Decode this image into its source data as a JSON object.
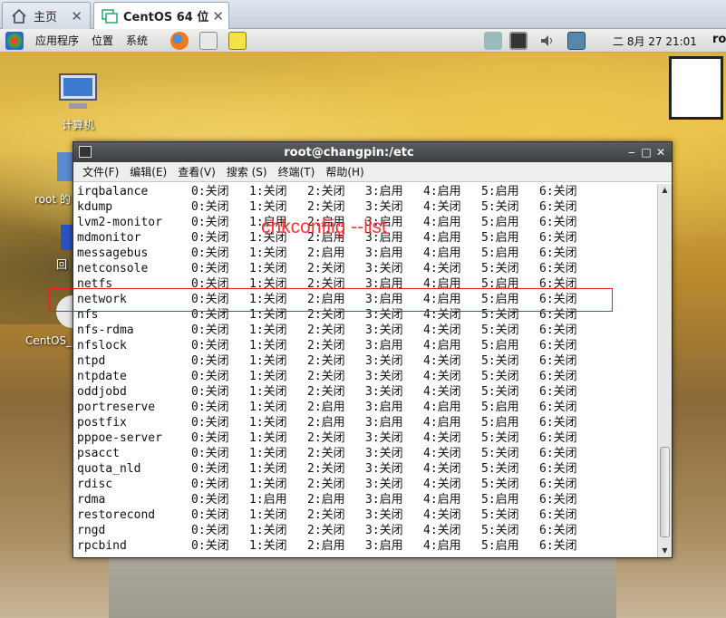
{
  "host_tabs": [
    {
      "label": "主页",
      "icon": "home-icon"
    },
    {
      "label": "CentOS 64 位",
      "icon": "vm-icon",
      "close": "✕"
    }
  ],
  "home_close": "✕",
  "panel": {
    "menus": [
      "应用程序",
      "位置",
      "系统"
    ],
    "clock": "二 8月 27 21:01",
    "user": "ro"
  },
  "desktop": {
    "icons": [
      {
        "label": "计算机",
        "icon": "computer-icon"
      },
      {
        "label": "root 的",
        "icon": "home-folder-icon"
      },
      {
        "label": "回",
        "icon": "trash-icon"
      },
      {
        "label": "CentOS_",
        "icon": "disc-icon"
      }
    ]
  },
  "terminal": {
    "title": "root@changpin:/etc",
    "window_buttons": [
      "‒",
      "□",
      "✕"
    ],
    "menu": [
      "文件(F)",
      "编辑(E)",
      "查看(V)",
      "搜索 (S)",
      "终端(T)",
      "帮助(H)"
    ],
    "rows": [
      {
        "name": "irqbalance",
        "levels": [
          "0:关闭",
          "1:关闭",
          "2:关闭",
          "3:启用",
          "4:启用",
          "5:启用",
          "6:关闭"
        ]
      },
      {
        "name": "kdump",
        "levels": [
          "0:关闭",
          "1:关闭",
          "2:关闭",
          "3:关闭",
          "4:关闭",
          "5:关闭",
          "6:关闭"
        ]
      },
      {
        "name": "lvm2-monitor",
        "levels": [
          "0:关闭",
          "1:启用",
          "2:启用",
          "3:启用",
          "4:启用",
          "5:启用",
          "6:关闭"
        ]
      },
      {
        "name": "mdmonitor",
        "levels": [
          "0:关闭",
          "1:关闭",
          "2:启用",
          "3:启用",
          "4:启用",
          "5:启用",
          "6:关闭"
        ]
      },
      {
        "name": "messagebus",
        "levels": [
          "0:关闭",
          "1:关闭",
          "2:启用",
          "3:启用",
          "4:启用",
          "5:启用",
          "6:关闭"
        ]
      },
      {
        "name": "netconsole",
        "levels": [
          "0:关闭",
          "1:关闭",
          "2:关闭",
          "3:关闭",
          "4:关闭",
          "5:关闭",
          "6:关闭"
        ]
      },
      {
        "name": "netfs",
        "levels": [
          "0:关闭",
          "1:关闭",
          "2:关闭",
          "3:启用",
          "4:启用",
          "5:启用",
          "6:关闭"
        ]
      },
      {
        "name": "network",
        "levels": [
          "0:关闭",
          "1:关闭",
          "2:启用",
          "3:启用",
          "4:启用",
          "5:启用",
          "6:关闭"
        ]
      },
      {
        "name": "nfs",
        "levels": [
          "0:关闭",
          "1:关闭",
          "2:关闭",
          "3:关闭",
          "4:关闭",
          "5:关闭",
          "6:关闭"
        ]
      },
      {
        "name": "nfs-rdma",
        "levels": [
          "0:关闭",
          "1:关闭",
          "2:关闭",
          "3:关闭",
          "4:关闭",
          "5:关闭",
          "6:关闭"
        ]
      },
      {
        "name": "nfslock",
        "levels": [
          "0:关闭",
          "1:关闭",
          "2:关闭",
          "3:启用",
          "4:启用",
          "5:启用",
          "6:关闭"
        ]
      },
      {
        "name": "ntpd",
        "levels": [
          "0:关闭",
          "1:关闭",
          "2:关闭",
          "3:关闭",
          "4:关闭",
          "5:关闭",
          "6:关闭"
        ]
      },
      {
        "name": "ntpdate",
        "levels": [
          "0:关闭",
          "1:关闭",
          "2:关闭",
          "3:关闭",
          "4:关闭",
          "5:关闭",
          "6:关闭"
        ]
      },
      {
        "name": "oddjobd",
        "levels": [
          "0:关闭",
          "1:关闭",
          "2:关闭",
          "3:关闭",
          "4:关闭",
          "5:关闭",
          "6:关闭"
        ]
      },
      {
        "name": "portreserve",
        "levels": [
          "0:关闭",
          "1:关闭",
          "2:启用",
          "3:启用",
          "4:启用",
          "5:启用",
          "6:关闭"
        ]
      },
      {
        "name": "postfix",
        "levels": [
          "0:关闭",
          "1:关闭",
          "2:启用",
          "3:启用",
          "4:启用",
          "5:启用",
          "6:关闭"
        ]
      },
      {
        "name": "pppoe-server",
        "levels": [
          "0:关闭",
          "1:关闭",
          "2:关闭",
          "3:关闭",
          "4:关闭",
          "5:关闭",
          "6:关闭"
        ]
      },
      {
        "name": "psacct",
        "levels": [
          "0:关闭",
          "1:关闭",
          "2:关闭",
          "3:关闭",
          "4:关闭",
          "5:关闭",
          "6:关闭"
        ]
      },
      {
        "name": "quota_nld",
        "levels": [
          "0:关闭",
          "1:关闭",
          "2:关闭",
          "3:关闭",
          "4:关闭",
          "5:关闭",
          "6:关闭"
        ]
      },
      {
        "name": "rdisc",
        "levels": [
          "0:关闭",
          "1:关闭",
          "2:关闭",
          "3:关闭",
          "4:关闭",
          "5:关闭",
          "6:关闭"
        ]
      },
      {
        "name": "rdma",
        "levels": [
          "0:关闭",
          "1:启用",
          "2:启用",
          "3:启用",
          "4:启用",
          "5:启用",
          "6:关闭"
        ]
      },
      {
        "name": "restorecond",
        "levels": [
          "0:关闭",
          "1:关闭",
          "2:关闭",
          "3:关闭",
          "4:关闭",
          "5:关闭",
          "6:关闭"
        ]
      },
      {
        "name": "rngd",
        "levels": [
          "0:关闭",
          "1:关闭",
          "2:关闭",
          "3:关闭",
          "4:关闭",
          "5:关闭",
          "6:关闭"
        ]
      },
      {
        "name": "rpcbind",
        "levels": [
          "0:关闭",
          "1:关闭",
          "2:启用",
          "3:启用",
          "4:启用",
          "5:启用",
          "6:关闭"
        ]
      }
    ]
  },
  "annotation": {
    "text": "chkconfiig --list",
    "color": "#ff3333"
  },
  "colors": {
    "accent_red": "#e02020",
    "title_bar": "#4a4d50"
  }
}
